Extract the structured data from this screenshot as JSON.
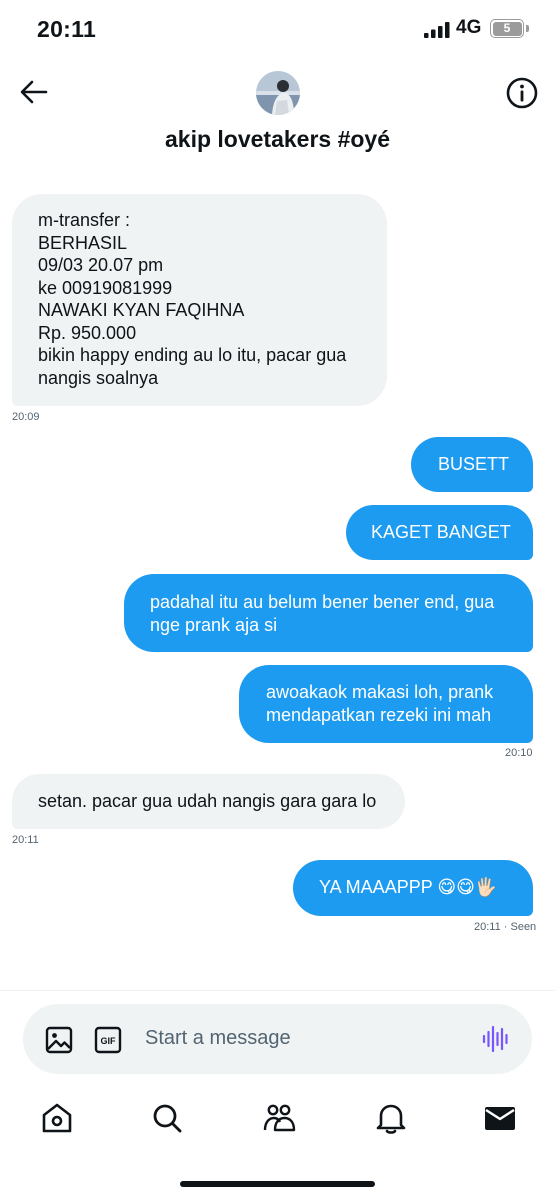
{
  "status_bar": {
    "time": "20:11",
    "network": "4G",
    "battery": "5"
  },
  "header": {
    "title": "akip lovetakers #oyé",
    "back_icon": "arrow-left-icon",
    "info_icon": "info-icon"
  },
  "messages": [
    {
      "direction": "incoming",
      "lines": [
        "m-transfer :",
        "BERHASIL",
        "09/03 20.07 pm",
        "ke 00919081999",
        "NAWAKI KYAN FAQIHNA",
        "Rp. 950.000",
        "bikin happy ending au lo itu, pacar gua",
        "nangis soalnya"
      ],
      "timestamp": "20:09"
    },
    {
      "direction": "outgoing",
      "lines": [
        "BUSETT"
      ]
    },
    {
      "direction": "outgoing",
      "lines": [
        "KAGET BANGET"
      ]
    },
    {
      "direction": "outgoing",
      "lines": [
        "padahal itu au belum bener bener end, gua",
        "nge prank aja si"
      ]
    },
    {
      "direction": "outgoing",
      "lines": [
        "awoakaok makasi loh, prank",
        "mendapatkan rezeki ini mah"
      ],
      "timestamp": "20:10"
    },
    {
      "direction": "incoming",
      "lines": [
        "setan. pacar gua udah nangis gara gara lo"
      ],
      "timestamp": "20:11"
    },
    {
      "direction": "outgoing",
      "lines": [
        "YA MAAAPPP 😋😋🖐🏻"
      ],
      "timestamp": "20:11 · Seen"
    }
  ],
  "composer": {
    "placeholder": "Start a message",
    "gif_label": "GIF"
  },
  "tab_bar": [
    "home-icon",
    "search-icon",
    "communities-icon",
    "notifications-icon",
    "messages-icon"
  ],
  "colors": {
    "outgoing_bubble": "#1d9bf0",
    "incoming_bubble": "#eff3f4",
    "voice_accent": "#7856ff"
  }
}
